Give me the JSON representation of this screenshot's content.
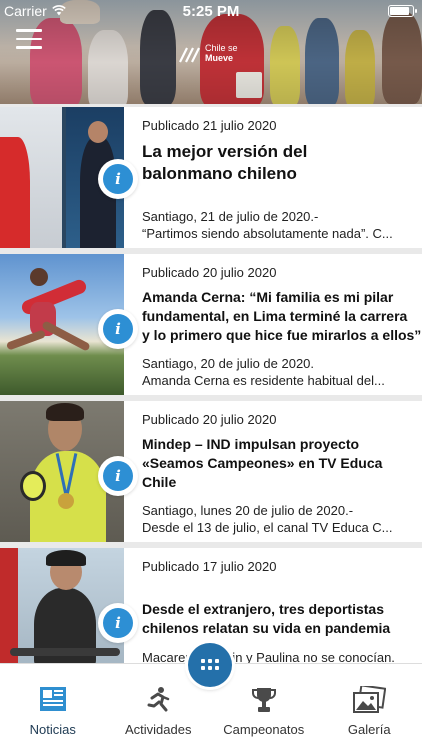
{
  "status_bar": {
    "carrier": "Carrier",
    "time": "5:25 PM",
    "battery_level": 0.9
  },
  "header": {
    "logo_line1": "Chile se",
    "logo_line2": "Mueve"
  },
  "news": [
    {
      "date": "Publicado 21 julio 2020",
      "title_lines": [
        "La mejor versión del",
        "balonmano chileno"
      ],
      "snippet_lines": [
        "Santiago, 21 de julio de 2020.-",
        "“Partimos siendo absolutamente nada”. C..."
      ]
    },
    {
      "date": "Publicado 20 julio 2020",
      "title_lines": [
        "Amanda Cerna: “Mi familia es mi pilar",
        "fundamental, en Lima terminé la carrera",
        "y lo primero que hice fue mirarlos a ellos”"
      ],
      "snippet_lines": [
        "Santiago, 20 de julio de 2020.",
        "Amanda Cerna es residente habitual del..."
      ]
    },
    {
      "date": "Publicado 20 julio 2020",
      "title_lines": [
        "Mindep – IND impulsan proyecto",
        "«Seamos Campeones» en TV Educa",
        "Chile"
      ],
      "snippet_lines": [
        "Santiago, lunes 20 de julio de 2020.-",
        "Desde el 13 de julio, el canal TV Educa C..."
      ]
    },
    {
      "date": "Publicado 17 julio 2020",
      "title_lines": [
        "Desde el extranjero, tres deportistas",
        "chilenos relatan su vida en pandemia"
      ],
      "snippet_lines": [
        "Macarena, Marlin y Paulina no se conocían."
      ]
    }
  ],
  "info_badge": "i",
  "tabs": [
    {
      "label": "Noticias",
      "icon": "newspaper-icon",
      "active": true
    },
    {
      "label": "Actividades",
      "icon": "runner-icon",
      "active": false
    },
    {
      "label": "Campeonatos",
      "icon": "trophy-icon",
      "active": false
    },
    {
      "label": "Galería",
      "icon": "gallery-icon",
      "active": false
    }
  ],
  "colors": {
    "accent": "#2d8fd4",
    "fab": "#2470aa",
    "active_tab": "#2f8fd0",
    "inactive_icon": "#4a4a4a"
  }
}
